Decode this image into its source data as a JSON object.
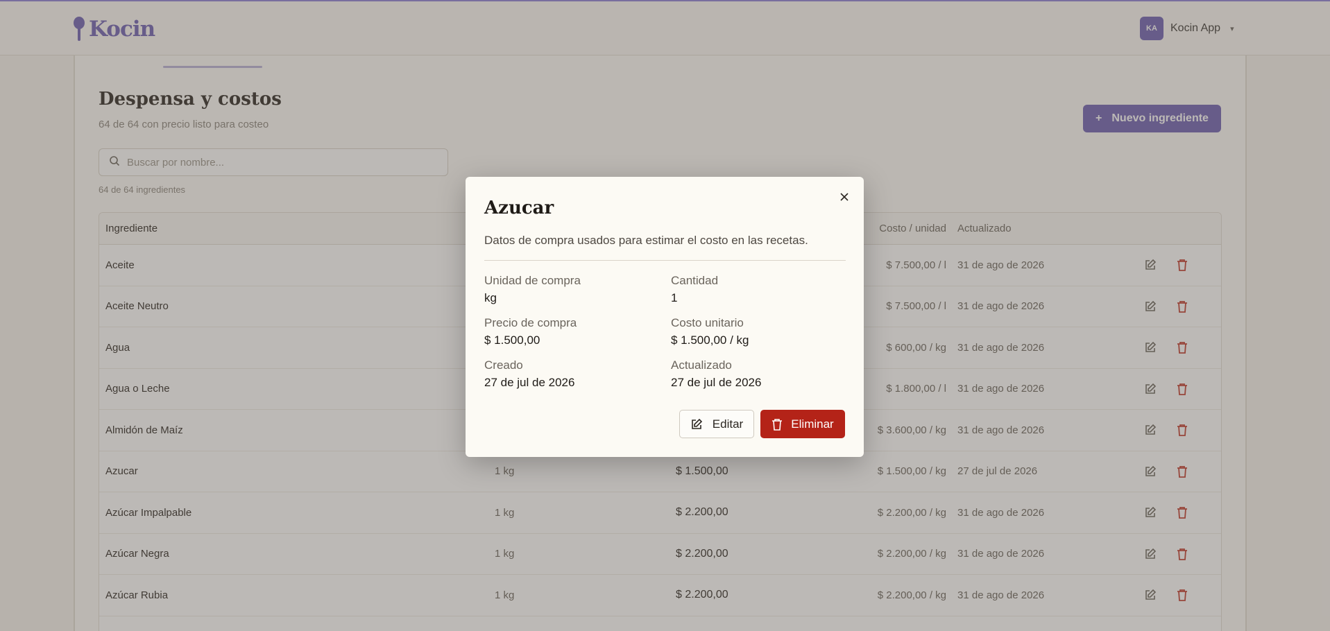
{
  "header": {
    "brand": "Kocin",
    "user_initials": "KA",
    "user_name": "Kocin App"
  },
  "page": {
    "title": "Despensa y costos",
    "subtitle": "64 de 64 con precio listo para costeo",
    "new_button": "Nuevo ingrediente",
    "search_placeholder": "Buscar por nombre...",
    "count": "64 de 64 ingredientes"
  },
  "table": {
    "headers": {
      "name": "Ingrediente",
      "unit_cost": "Costo / unidad",
      "updated": "Actualizado"
    },
    "rows": [
      {
        "name": "Aceite",
        "qty": "",
        "price": "",
        "unit_cost": "$ 7.500,00 / l",
        "updated": "31 de ago de 2026"
      },
      {
        "name": "Aceite Neutro",
        "qty": "",
        "price": "",
        "unit_cost": "$ 7.500,00 / l",
        "updated": "31 de ago de 2026"
      },
      {
        "name": "Agua",
        "qty": "",
        "price": "",
        "unit_cost": "$ 600,00 / kg",
        "updated": "31 de ago de 2026"
      },
      {
        "name": "Agua o Leche",
        "qty": "",
        "price": "",
        "unit_cost": "$ 1.800,00 / l",
        "updated": "31 de ago de 2026"
      },
      {
        "name": "Almidón de Maíz",
        "qty": "",
        "price": "",
        "unit_cost": "$ 3.600,00 / kg",
        "updated": "31 de ago de 2026"
      },
      {
        "name": "Azucar",
        "qty": "1 kg",
        "price": "$ 1.500,00",
        "unit_cost": "$ 1.500,00 / kg",
        "updated": "27 de jul de 2026"
      },
      {
        "name": "Azúcar Impalpable",
        "qty": "1 kg",
        "price": "$ 2.200,00",
        "unit_cost": "$ 2.200,00 / kg",
        "updated": "31 de ago de 2026"
      },
      {
        "name": "Azúcar Negra",
        "qty": "1 kg",
        "price": "$ 2.200,00",
        "unit_cost": "$ 2.200,00 / kg",
        "updated": "31 de ago de 2026"
      },
      {
        "name": "Azúcar Rubia",
        "qty": "1 kg",
        "price": "$ 2.200,00",
        "unit_cost": "$ 2.200,00 / kg",
        "updated": "31 de ago de 2026"
      },
      {
        "name": "",
        "qty": "",
        "price": "",
        "unit_cost": "",
        "updated": ""
      }
    ]
  },
  "modal": {
    "title": "Azucar",
    "description": "Datos de compra usados para estimar el costo en las recetas.",
    "fields": {
      "unit_label": "Unidad de compra",
      "unit_value": "kg",
      "qty_label": "Cantidad",
      "qty_value": "1",
      "price_label": "Precio de compra",
      "price_value": "$ 1.500,00",
      "unit_cost_label": "Costo unitario",
      "unit_cost_value": "$ 1.500,00 / kg",
      "created_label": "Creado",
      "created_value": "27 de jul de 2026",
      "updated_label": "Actualizado",
      "updated_value": "27 de jul de 2026"
    },
    "edit_label": "Editar",
    "delete_label": "Eliminar"
  },
  "colors": {
    "brand": "#6d5fb2",
    "danger": "#b42318",
    "overlay": "#5f5852"
  }
}
